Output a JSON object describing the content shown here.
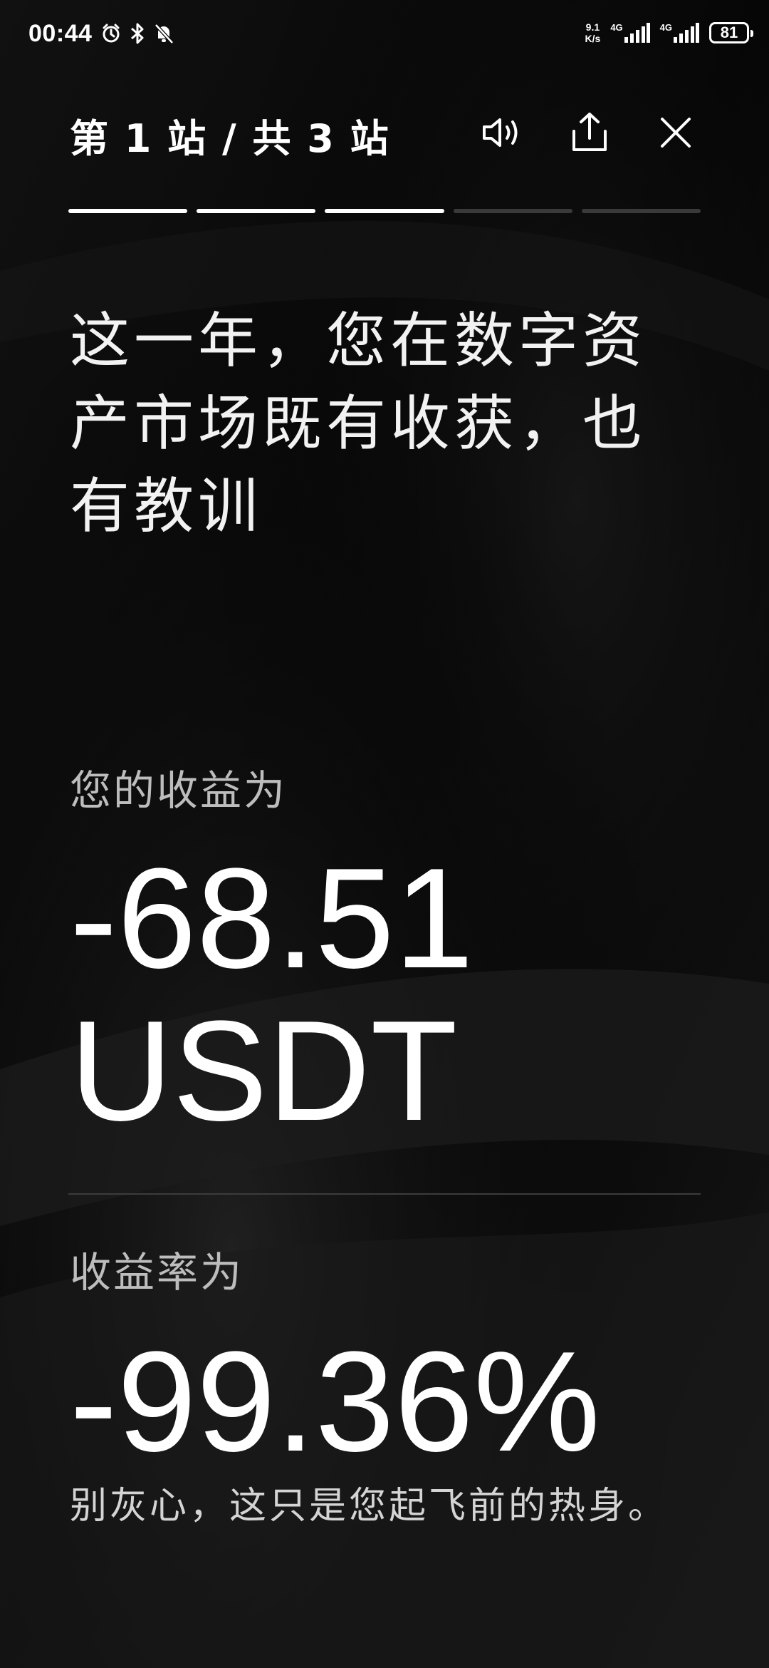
{
  "status_bar": {
    "time": "00:44",
    "network_speed_value": "9.1",
    "network_speed_unit": "K/s",
    "sim1_label": "4G",
    "sim2_label": "4G",
    "battery": "81"
  },
  "header": {
    "title": "第 1 站 / 共 3 站"
  },
  "progress": {
    "segments_total": 5,
    "segments_active": 3
  },
  "content": {
    "headline": "这一年，您在数字资产市场既有收获，也有教训",
    "profit_label": "您的收益为",
    "profit_value": "-68.51",
    "profit_unit": "USDT",
    "rate_label": "收益率为",
    "rate_value": "-99.36%",
    "encouragement": "别灰心，这只是您起飞前的热身。"
  },
  "colors": {
    "background": "#0a0a0a",
    "text_primary": "#ffffff",
    "text_secondary": "#bdbdbd",
    "progress_active": "#ffffff",
    "progress_inactive": "#3a3a3a"
  },
  "icons": {
    "alarm": "alarm-icon",
    "bluetooth": "bluetooth-icon",
    "mute": "mute-icon",
    "sound": "speaker-icon",
    "share": "share-icon",
    "close": "close-icon"
  }
}
